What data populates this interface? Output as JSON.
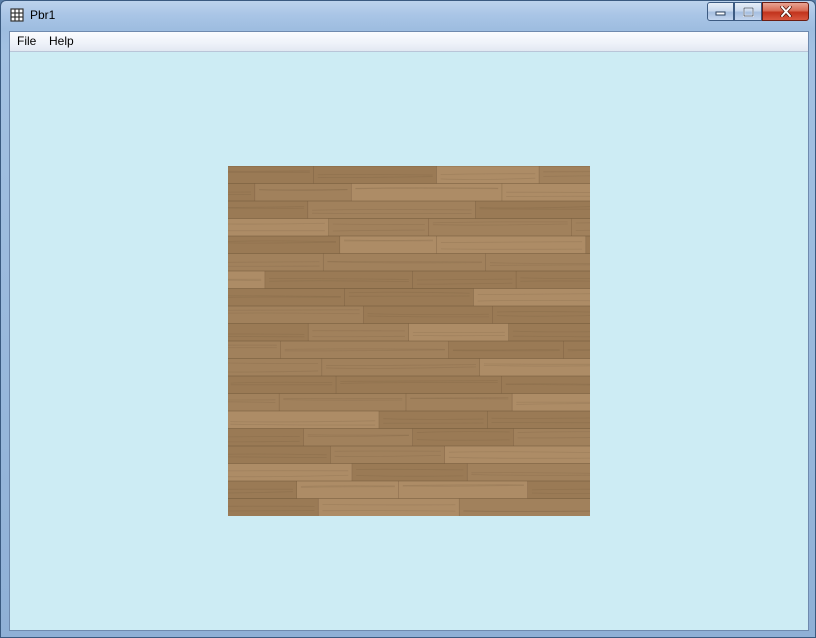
{
  "window": {
    "title": "Pbr1",
    "app_icon": "app-grid-icon",
    "controls": [
      "minimize-icon",
      "maximize-icon",
      "close-icon"
    ]
  },
  "menu": {
    "items": [
      {
        "label": "File"
      },
      {
        "label": "Help"
      }
    ]
  },
  "viewport": {
    "background_color": "#cdecf4",
    "content": "wood-plank-texture",
    "texture_colors": {
      "base": "#9a7a55",
      "light": "#ad8c66",
      "dark": "#6b5236"
    }
  }
}
